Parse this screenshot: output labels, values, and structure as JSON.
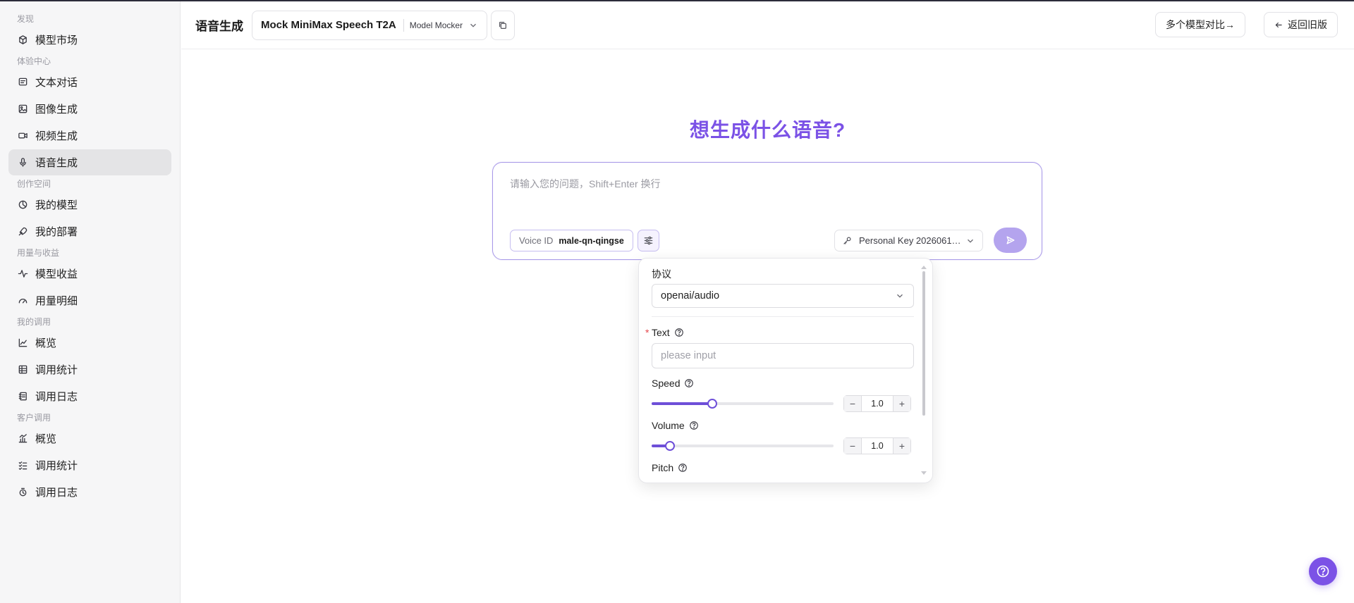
{
  "sidebar": {
    "groups": [
      {
        "label": "发现",
        "items": [
          {
            "label": "模型市场",
            "icon": "cube-icon"
          }
        ]
      },
      {
        "label": "体验中心",
        "items": [
          {
            "label": "文本对话",
            "icon": "chat-icon"
          },
          {
            "label": "图像生成",
            "icon": "image-icon"
          },
          {
            "label": "视频生成",
            "icon": "video-icon"
          },
          {
            "label": "语音生成",
            "icon": "mic-icon",
            "active": true
          }
        ]
      },
      {
        "label": "创作空间",
        "items": [
          {
            "label": "我的模型",
            "icon": "model-icon"
          },
          {
            "label": "我的部署",
            "icon": "rocket-icon"
          }
        ]
      },
      {
        "label": "用量与收益",
        "items": [
          {
            "label": "模型收益",
            "icon": "pulse-icon"
          },
          {
            "label": "用量明细",
            "icon": "gauge-icon"
          }
        ]
      },
      {
        "label": "我的调用",
        "items": [
          {
            "label": "概览",
            "icon": "line-chart-icon"
          },
          {
            "label": "调用统计",
            "icon": "table-icon"
          },
          {
            "label": "调用日志",
            "icon": "log-icon"
          }
        ]
      },
      {
        "label": "客户调用",
        "items": [
          {
            "label": "概览",
            "icon": "bar-chart-icon"
          },
          {
            "label": "调用统计",
            "icon": "checklist-icon"
          },
          {
            "label": "调用日志",
            "icon": "log-alt-icon"
          }
        ]
      }
    ]
  },
  "header": {
    "title": "语音生成",
    "model_name": "Mock MiniMax Speech T2A",
    "model_provider": "Model Mocker",
    "compare_label": "多个模型对比→",
    "back_label": "返回旧版"
  },
  "main": {
    "heading": "想生成什么语音?",
    "prompt_placeholder": "请输入您的问题，Shift+Enter 换行",
    "voice_label": "Voice ID",
    "voice_value": "male-qn-qingse",
    "key_label": "Personal Key 20260616..."
  },
  "panel": {
    "protocol_label": "协议",
    "protocol_value": "openai/audio",
    "text_label": "Text",
    "text_placeholder": "please input",
    "speed_label": "Speed",
    "speed_value": "1.0",
    "speed_fraction": 0.333,
    "volume_label": "Volume",
    "volume_value": "1.0",
    "volume_fraction": 0.1,
    "pitch_label": "Pitch",
    "minus": "−",
    "plus": "+"
  },
  "colors": {
    "accent": "#7b52e6",
    "slider": "#6e4fd8",
    "send_disabled": "#b4a4ee"
  }
}
